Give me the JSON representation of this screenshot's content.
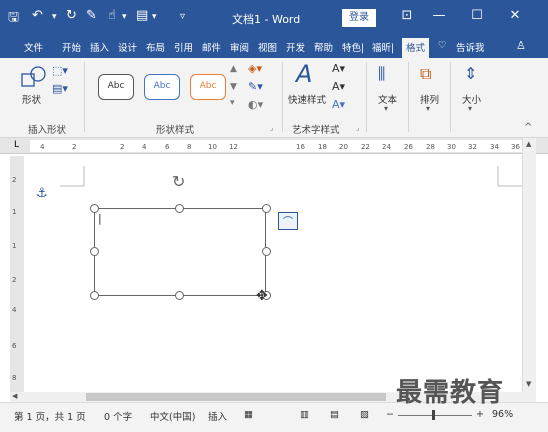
{
  "titlebar": {
    "title": "文档1 - Word",
    "login": "登录",
    "bg": "#2b579a"
  },
  "tabs": [
    "文件",
    "开始",
    "插入",
    "设计",
    "布局",
    "引用",
    "邮件",
    "审阅",
    "视图",
    "开发",
    "帮助",
    "特色|",
    "福昕|",
    "格式",
    "告诉我"
  ],
  "ribbon": {
    "shape_label": "形状",
    "insert_shape_group": "插入形状",
    "abc": [
      "Abc",
      "Abc",
      "Abc"
    ],
    "shape_style_group": "形状样式",
    "quick_style": "快速样式",
    "wordart_group": "艺术字样式",
    "text": "文本",
    "arrange": "排列",
    "size": "大小"
  },
  "ruler_h_nums": [
    "4",
    "2",
    "2",
    "4",
    "6",
    "8",
    "10",
    "12",
    "16",
    "18",
    "20",
    "22",
    "24",
    "26",
    "28",
    "30",
    "32",
    "34",
    "36",
    "38"
  ],
  "ruler_v_nums": [
    "2",
    "1",
    "1",
    "2",
    "4",
    "6",
    "8"
  ],
  "status": {
    "page": "第 1 页，共 1 页",
    "words": "0 个字",
    "lang": "中文(中国)",
    "mode": "插入",
    "zoom": "96%"
  },
  "watermark": "最需教育"
}
